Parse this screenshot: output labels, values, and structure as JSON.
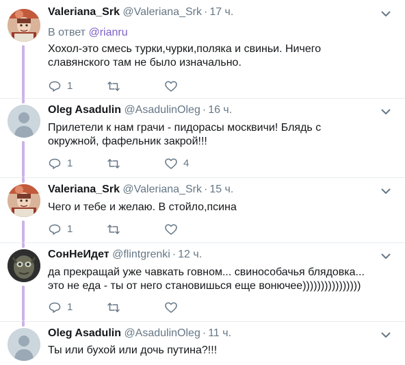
{
  "tweets": [
    {
      "name": "Valeriana_Srk",
      "handle": "@Valeriana_Srk",
      "time": "17 ч.",
      "reply_prefix": "В ответ",
      "reply_mention": "@rianru",
      "text_lines": [
        "Хохол-это смесь турки,чурки,поляка и свиньи. Ничего",
        "славянского там не было изначально."
      ],
      "replies": "1",
      "retweets": "",
      "likes": "",
      "avatar": "valeriana-photo"
    },
    {
      "name": "Oleg Asadulin",
      "handle": "@AsadulinOleg",
      "time": "16 ч.",
      "text_lines": [
        "Прилетели к нам грачи - пидорасы москвичи! Блядь с",
        "окружной, фафельник закрой!!!"
      ],
      "replies": "1",
      "retweets": "",
      "likes": "4",
      "avatar": "default-egg"
    },
    {
      "name": "Valeriana_Srk",
      "handle": "@Valeriana_Srk",
      "time": "15 ч.",
      "text_lines": [
        "Чего и тебе и желаю. В стойло,псина"
      ],
      "replies": "1",
      "retweets": "",
      "likes": "",
      "avatar": "valeriana-photo"
    },
    {
      "name": "СонНеИдет",
      "handle": "@flintgrenki",
      "time": "12 ч.",
      "text_lines": [
        "да прекращай уже чавкать говном... свинособачья блядовка...",
        "это не еда - ты от него становишься еще вонючее))))))))))))))))"
      ],
      "replies": "1",
      "retweets": "",
      "likes": "",
      "avatar": "gollum-photo"
    },
    {
      "name": "Oleg Asadulin",
      "handle": "@AsadulinOleg",
      "time": "11 ч.",
      "text_lines": [
        "Ты или бухой или дочь путина?!!!"
      ],
      "replies": "",
      "retweets": "",
      "likes": "",
      "avatar": "default-egg"
    }
  ],
  "colors": {
    "text": "#14171a",
    "secondary": "#657786",
    "mention": "#7b5fc7",
    "thread_line": "#ccb3e6",
    "separator": "#e6ecf0"
  }
}
